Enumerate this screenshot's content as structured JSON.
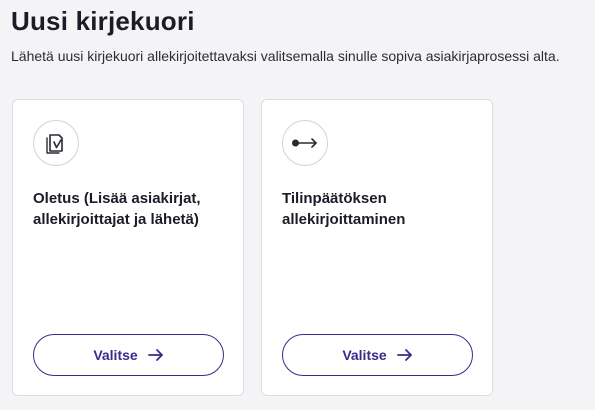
{
  "header": {
    "title": "Uusi kirjekuori",
    "subtitle": "Lähetä uusi kirjekuori allekirjoitettavaksi valitsemalla sinulle sopiva asiakirjaprosessi alta."
  },
  "cards": [
    {
      "icon": "document-sign-icon",
      "title": "Oletus (Lisää asiakirjat, allekirjoittajat ja lähetä)",
      "button_label": "Valitse",
      "button_icon": "arrow-right-icon"
    },
    {
      "icon": "flow-arrow-icon",
      "title": "Tilinpäätöksen allekirjoittaminen",
      "button_label": "Valitse",
      "button_icon": "arrow-right-icon"
    }
  ],
  "colors": {
    "accent": "#3b2a8c",
    "background": "#f4f4f6",
    "card": "#ffffff",
    "text": "#1c1c28"
  }
}
